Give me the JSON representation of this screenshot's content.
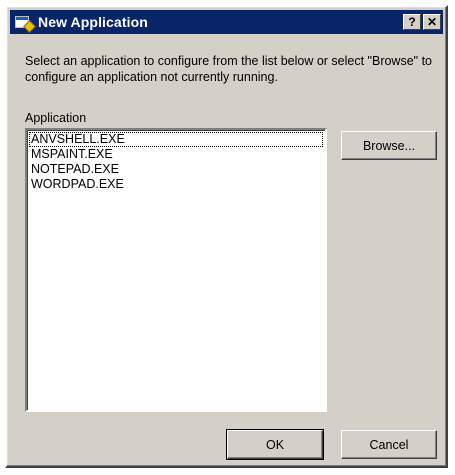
{
  "window": {
    "title": "New Application",
    "help_glyph": "?",
    "close_glyph": "✕"
  },
  "prompt": "Select an application to configure from the list below or select \"Browse\" to configure an application not currently running.",
  "list": {
    "label": "Application",
    "items": [
      "ANVSHELL.EXE",
      "MSPAINT.EXE",
      "NOTEPAD.EXE",
      "WORDPAD.EXE"
    ]
  },
  "buttons": {
    "browse": "Browse...",
    "ok": "OK",
    "cancel": "Cancel"
  },
  "colors": {
    "titlebar": "#0a246a",
    "face": "#d4d0c8"
  }
}
